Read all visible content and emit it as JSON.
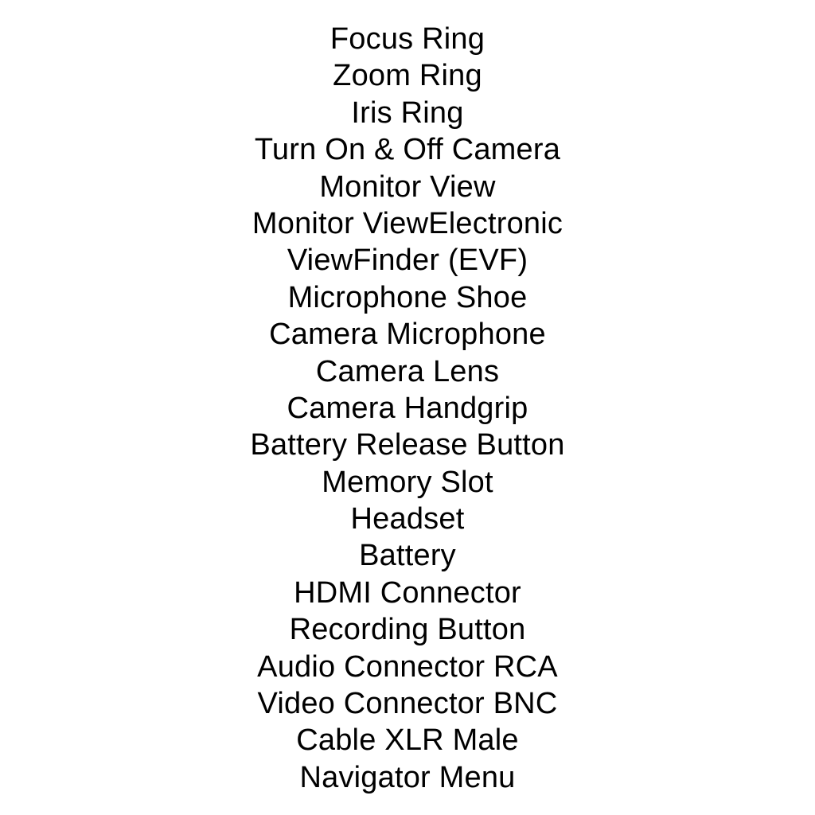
{
  "text_color": "#000000",
  "background_color": "#ffffff",
  "labels": [
    "Focus Ring",
    "Zoom Ring",
    "Iris Ring",
    "Turn On & Off Camera",
    "Monitor View",
    "Monitor ViewElectronic",
    "ViewFinder (EVF)",
    "Microphone Shoe",
    "Camera Microphone",
    "Camera Lens",
    "Camera Handgrip",
    "Battery Release Button",
    "Memory Slot",
    "Headset",
    "Battery",
    "HDMI Connector",
    "Recording Button",
    "Audio Connector RCA",
    "Video Connector BNC",
    "Cable XLR Male",
    "Navigator Menu"
  ]
}
